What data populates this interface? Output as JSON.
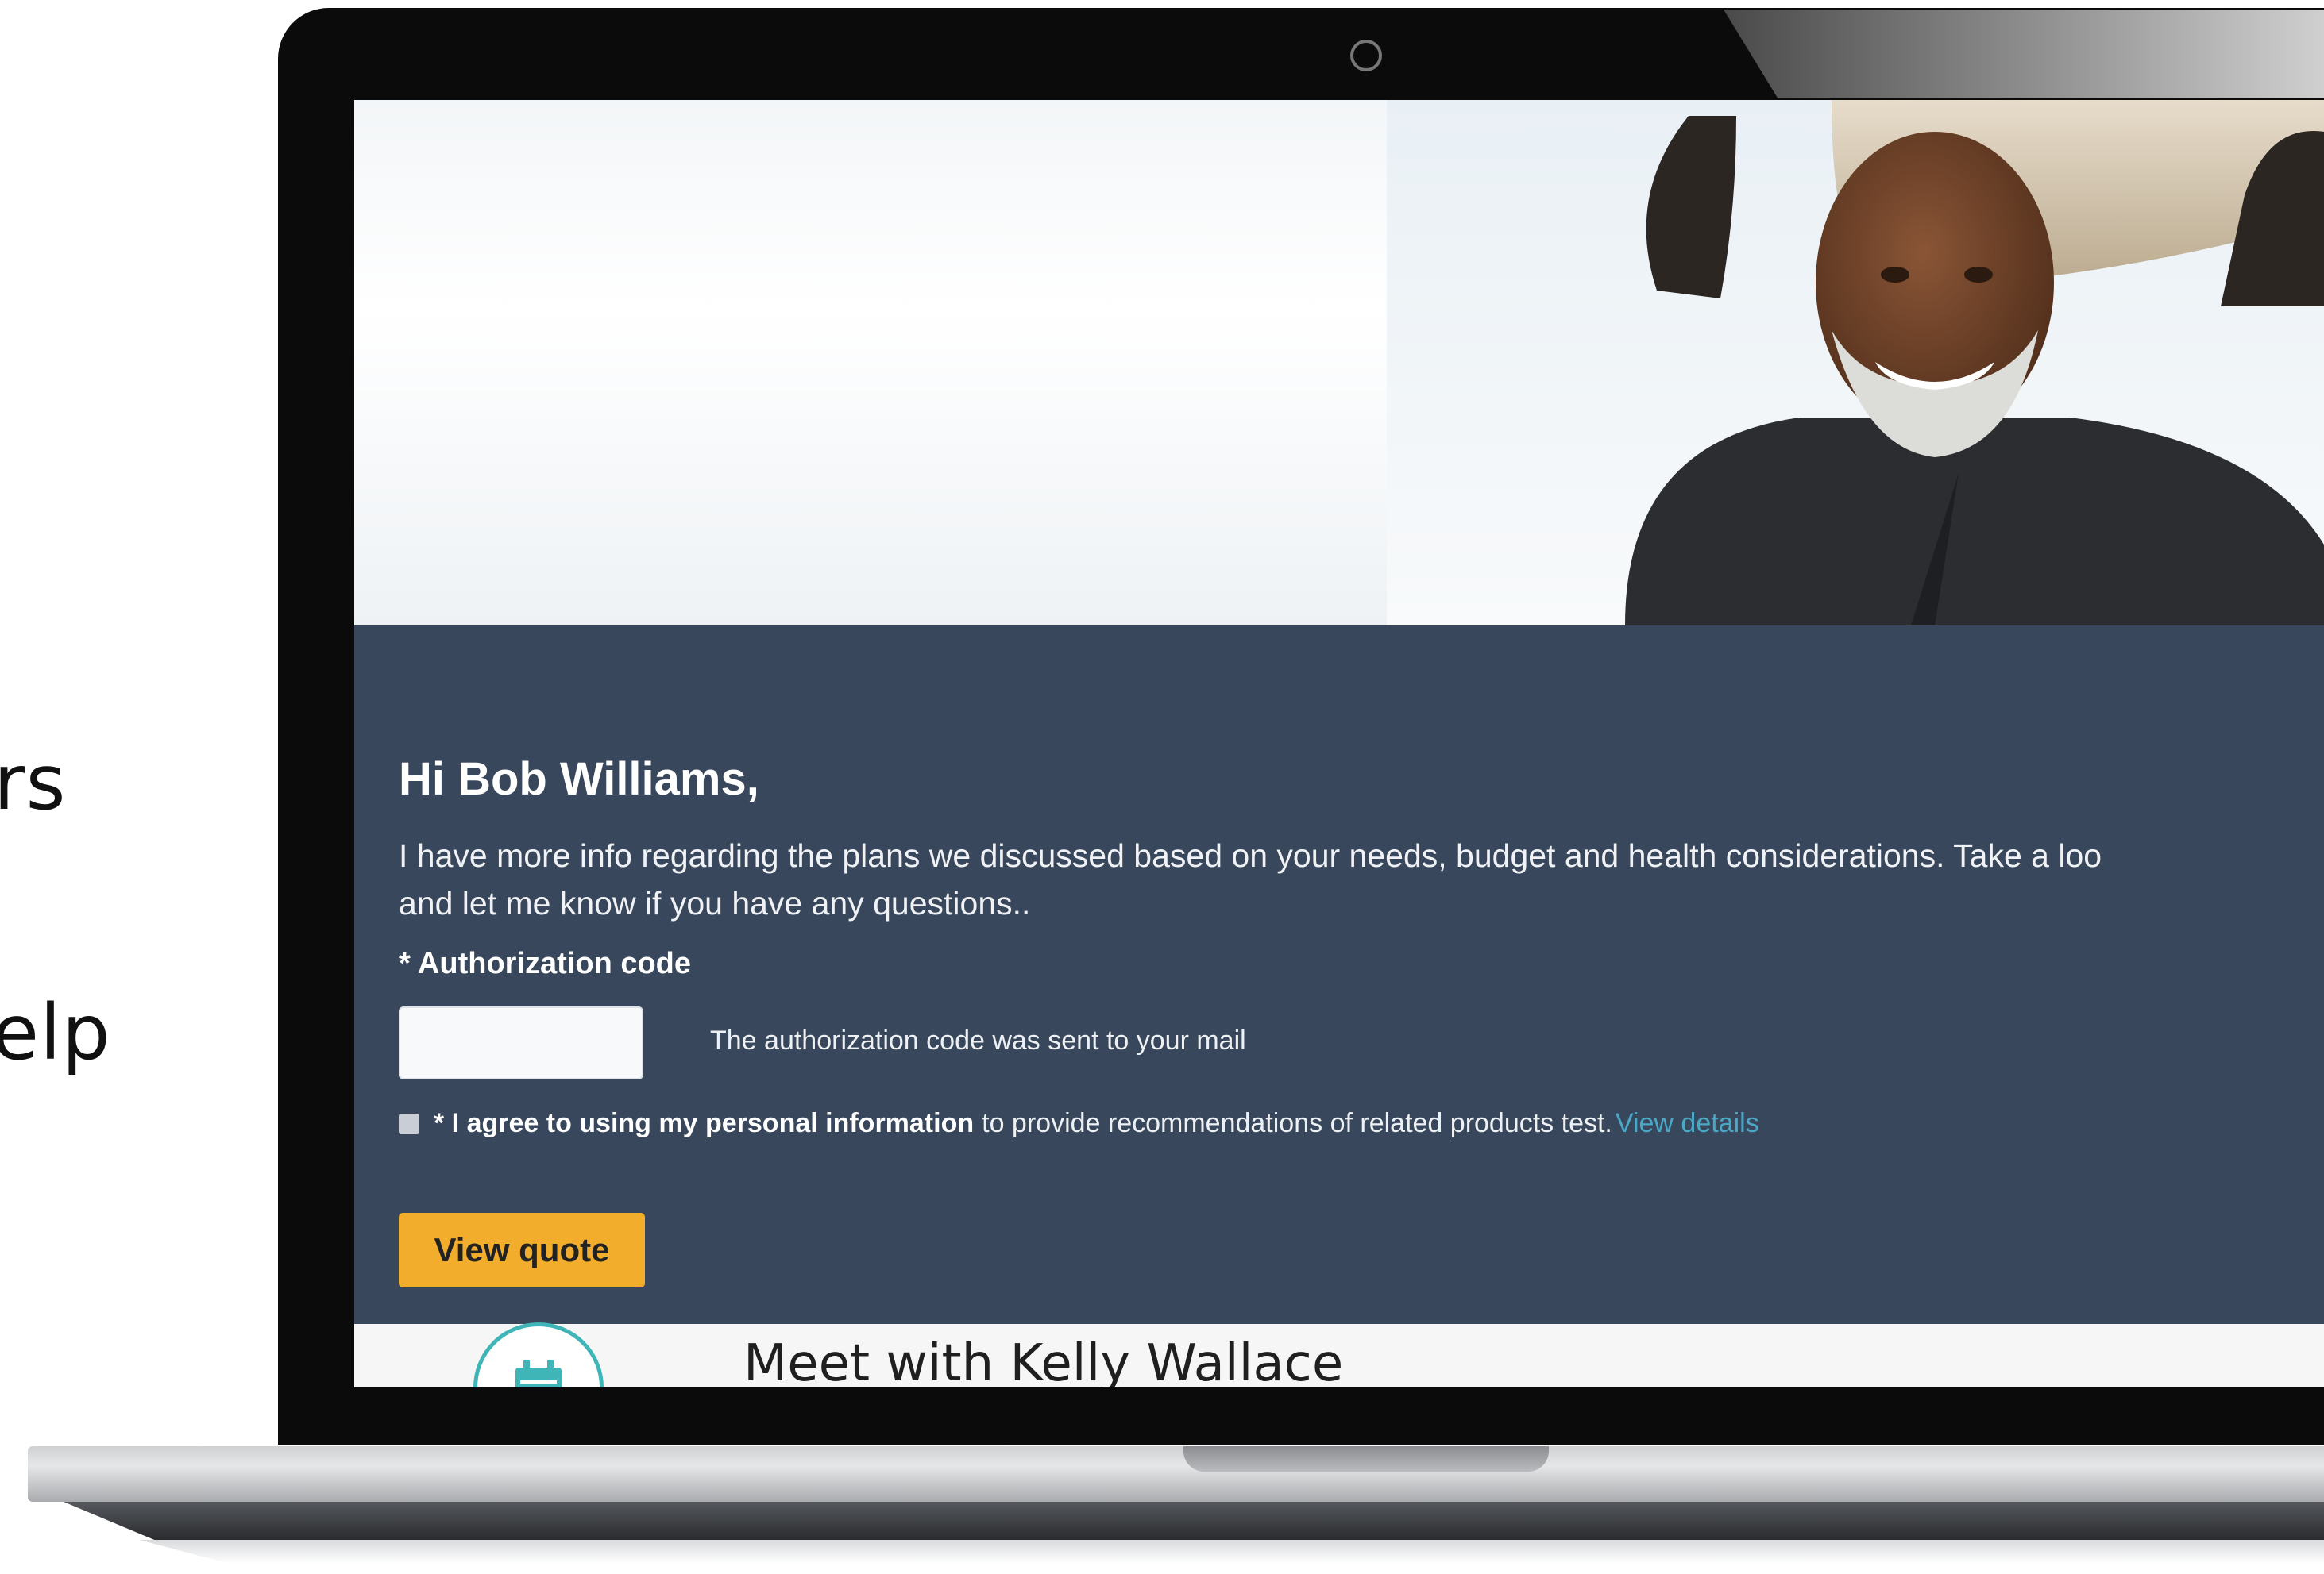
{
  "page": {
    "side_text_1": "rs",
    "side_text_2": "elp"
  },
  "hero": {
    "image": "smiling-man-holding-surfboard-photo"
  },
  "panel": {
    "greeting": "Hi  Bob Williams,",
    "intro_line_1": "I have more info regarding the plans we discussed based on your needs, budget and health considerations. Take a loo",
    "intro_line_2": "and let me know if you have any questions..",
    "auth_label": "* Authorization code",
    "auth_value": "",
    "auth_hint": "The authorization code was sent to your mail",
    "consent_required_marker": "* I agree to using my personal information",
    "consent_rest": "to provide recommendations of related products test.",
    "consent_link": "View details",
    "consent_checked": false,
    "cta_label": "View quote"
  },
  "meet": {
    "title": "Meet with Kelly Wallace",
    "icon": "calendar-icon"
  },
  "colors": {
    "panel_bg": "#38475c",
    "cta_bg": "#f1ad2b",
    "link": "#4aa8c7",
    "accent_teal": "#3fb5b7"
  }
}
